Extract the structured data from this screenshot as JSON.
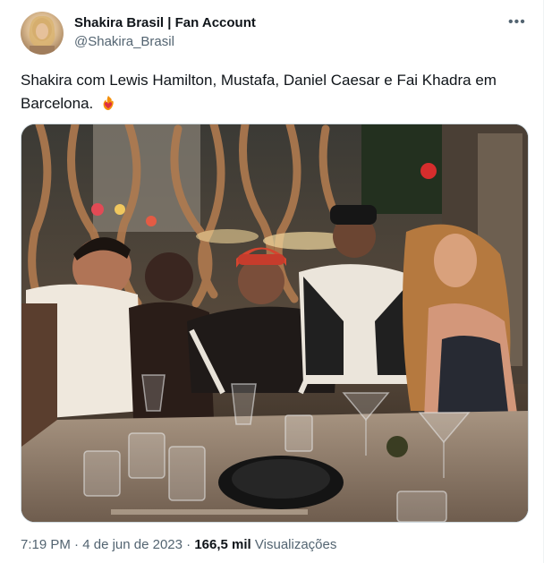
{
  "tweet": {
    "display_name": "Shakira Brasil | Fan Account",
    "handle": "@Shakira_Brasil",
    "more_icon": "•••",
    "text": "Shakira com Lewis Hamilton, Mustafa, Daniel Caesar e Fai Khadra em Barcelona.",
    "emoji_icon": "heart-on-fire-icon",
    "time": "7:19 PM",
    "separator": "·",
    "date": "4 de jun de 2023",
    "views_count": "166,5 mil",
    "views_label": "Visualizações"
  },
  "colors": {
    "text_primary": "#0f1419",
    "text_secondary": "#536471",
    "border": "#cfd9de"
  }
}
